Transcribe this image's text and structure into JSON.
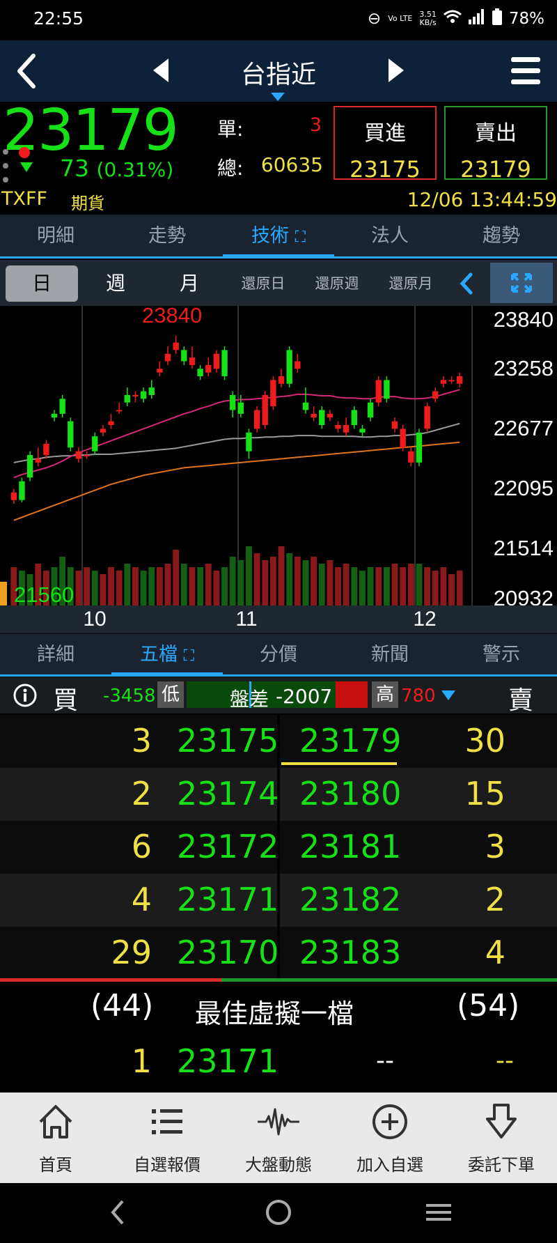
{
  "status": {
    "time": "22:55",
    "volte": "Vo LTE",
    "speed_value": "3.51",
    "speed_unit": "KB/s",
    "battery": "78%"
  },
  "header": {
    "title": "台指近"
  },
  "quote": {
    "price": "23179",
    "change": "73",
    "change_pct": "(0.31%)",
    "single_label": "單:",
    "single_value": "3",
    "total_label": "總:",
    "total_value": "60635",
    "buy_label": "買進",
    "buy_value": "23175",
    "sell_label": "賣出",
    "sell_value": "23179",
    "symbol": "TXFF",
    "type": "期貨",
    "datetime": "12/06 13:44:59"
  },
  "tabs_top": [
    "明細",
    "走勢",
    "技術",
    "法人",
    "趨勢"
  ],
  "tabs_top_active": "技術",
  "period": {
    "day": "日",
    "week": "週",
    "month": "月",
    "r_day": "還原日",
    "r_week": "還原週",
    "r_month": "還原月"
  },
  "chart_data": {
    "type": "candlestick",
    "high_label": "23840",
    "low_label": "21560",
    "price_axis": [
      "23840",
      "23258",
      "22677",
      "22095",
      "21514",
      "20932"
    ],
    "x_labels": [
      "10",
      "11",
      "12"
    ],
    "candles": [
      [
        21650,
        21750,
        21600,
        21800
      ],
      [
        21900,
        21650,
        21620,
        21950
      ],
      [
        22250,
        21950,
        21900,
        22300
      ],
      [
        22150,
        22200,
        22100,
        22350
      ],
      [
        22250,
        22400,
        22200,
        22450
      ],
      [
        22800,
        22750,
        22700,
        22850
      ],
      [
        23000,
        22800,
        22750,
        23050
      ],
      [
        22700,
        22350,
        22300,
        22750
      ],
      [
        22200,
        22300,
        22150,
        22350
      ],
      [
        22250,
        22250,
        22200,
        22300
      ],
      [
        22500,
        22300,
        22250,
        22550
      ],
      [
        22550,
        22600,
        22500,
        22650
      ],
      [
        22650,
        22700,
        22600,
        22800
      ],
      [
        22850,
        22850,
        22800,
        22950
      ],
      [
        23050,
        22950,
        22900,
        23150
      ],
      [
        23050,
        23050,
        22950,
        23100
      ],
      [
        23100,
        23000,
        22950,
        23150
      ],
      [
        23150,
        23050,
        23000,
        23250
      ],
      [
        23350,
        23400,
        23300,
        23500
      ],
      [
        23500,
        23600,
        23450,
        23700
      ],
      [
        23650,
        23750,
        23600,
        23840
      ],
      [
        23650,
        23500,
        23450,
        23700
      ],
      [
        23450,
        23550,
        23400,
        23700
      ],
      [
        23400,
        23300,
        23250,
        23450
      ],
      [
        23350,
        23450,
        23300,
        23550
      ],
      [
        23400,
        23600,
        23350,
        23650
      ],
      [
        23650,
        23300,
        23250,
        23700
      ],
      [
        23050,
        22850,
        22750,
        23100
      ],
      [
        22950,
        22800,
        22750,
        23050
      ],
      [
        22550,
        22300,
        22200,
        22600
      ],
      [
        22600,
        22850,
        22550,
        22900
      ],
      [
        22650,
        23050,
        22600,
        23100
      ],
      [
        22900,
        23250,
        22850,
        23300
      ],
      [
        23200,
        23300,
        23150,
        23400
      ],
      [
        23650,
        23200,
        23150,
        23700
      ],
      [
        23400,
        23500,
        23350,
        23600
      ],
      [
        22950,
        22850,
        22800,
        23150
      ],
      [
        22750,
        22800,
        22700,
        22900
      ],
      [
        22850,
        22650,
        22600,
        22900
      ],
      [
        22750,
        22800,
        22700,
        22850
      ],
      [
        22600,
        22650,
        22550,
        22700
      ],
      [
        22550,
        22650,
        22500,
        22750
      ],
      [
        22850,
        22650,
        22600,
        22900
      ],
      [
        22600,
        22550,
        22500,
        22650
      ],
      [
        22950,
        22750,
        22700,
        23000
      ],
      [
        22950,
        23250,
        22900,
        23300
      ],
      [
        23250,
        23000,
        22950,
        23300
      ],
      [
        22600,
        22700,
        22550,
        22750
      ],
      [
        22350,
        22600,
        22300,
        22650
      ],
      [
        22150,
        22300,
        22100,
        22350
      ],
      [
        22550,
        22150,
        22100,
        22600
      ],
      [
        22600,
        22900,
        22550,
        22950
      ],
      [
        23000,
        23100,
        22950,
        23150
      ],
      [
        23200,
        23250,
        23150,
        23300
      ],
      [
        23250,
        23250,
        23200,
        23300
      ],
      [
        23200,
        23300,
        23150,
        23350
      ]
    ],
    "ma_short": [
      21950,
      21990,
      22020,
      22050,
      22080,
      22120,
      22170,
      22230,
      22280,
      22320,
      22360,
      22400,
      22440,
      22480,
      22520,
      22560,
      22600,
      22640,
      22680,
      22720,
      22760,
      22800,
      22830,
      22870,
      22900,
      22940,
      22970,
      22980,
      22990,
      22990,
      23000,
      23010,
      23020,
      23030,
      23040,
      23060,
      23060,
      23050,
      23040,
      23040,
      23020,
      23010,
      23010,
      23000,
      23000,
      23020,
      23030,
      23030,
      23010,
      23000,
      23000,
      23010,
      23030,
      23060,
      23090,
      23120
    ],
    "ma_mid": [
      22150,
      22170,
      22190,
      22200,
      22220,
      22230,
      22240,
      22240,
      22250,
      22250,
      22260,
      22260,
      22260,
      22270,
      22280,
      22290,
      22300,
      22310,
      22320,
      22330,
      22340,
      22360,
      22380,
      22400,
      22420,
      22440,
      22460,
      22470,
      22470,
      22480,
      22480,
      22490,
      22490,
      22500,
      22500,
      22510,
      22510,
      22510,
      22500,
      22500,
      22500,
      22500,
      22500,
      22490,
      22490,
      22500,
      22500,
      22510,
      22510,
      22520,
      22530,
      22550,
      22580,
      22610,
      22640,
      22670
    ],
    "ma_long": [
      21380,
      21420,
      21460,
      21500,
      21540,
      21580,
      21620,
      21660,
      21700,
      21740,
      21780,
      21820,
      21860,
      21890,
      21920,
      21950,
      21980,
      22000,
      22020,
      22040,
      22060,
      22080,
      22090,
      22100,
      22110,
      22120,
      22130,
      22140,
      22150,
      22160,
      22170,
      22180,
      22190,
      22200,
      22210,
      22220,
      22230,
      22240,
      22250,
      22260,
      22270,
      22280,
      22290,
      22300,
      22310,
      22320,
      22330,
      22340,
      22350,
      22360,
      22370,
      22380,
      22390,
      22400,
      22410,
      22420
    ],
    "volume": [
      0.55,
      0.5,
      0.45,
      0.6,
      0.5,
      0.55,
      0.7,
      0.55,
      0.5,
      0.55,
      0.5,
      0.45,
      0.55,
      0.5,
      0.6,
      0.55,
      0.5,
      0.55,
      0.55,
      0.6,
      0.8,
      0.6,
      0.55,
      0.55,
      0.6,
      0.5,
      0.55,
      0.7,
      0.65,
      0.85,
      0.75,
      0.65,
      0.7,
      0.85,
      0.75,
      0.7,
      0.65,
      0.7,
      0.6,
      0.65,
      0.55,
      0.6,
      0.55,
      0.5,
      0.55,
      0.55,
      0.55,
      0.6,
      0.55,
      0.6,
      0.6,
      0.55,
      0.5,
      0.55,
      0.45,
      0.5
    ]
  },
  "tabs_mid": [
    "詳細",
    "五檔",
    "分價",
    "新聞",
    "警示"
  ],
  "tabs_mid_active": "五檔",
  "five": {
    "buy_label": "買",
    "sell_label": "賣",
    "low_diff": "-3458",
    "low_label": "低",
    "spread_label": "盤差",
    "spread_value": "-2007",
    "high_label": "高",
    "high_diff": "780",
    "rows": [
      {
        "bq": "3",
        "bp": "23175",
        "sp": "23179",
        "sq": "30"
      },
      {
        "bq": "2",
        "bp": "23174",
        "sp": "23180",
        "sq": "15"
      },
      {
        "bq": "6",
        "bp": "23172",
        "sp": "23181",
        "sq": "3"
      },
      {
        "bq": "4",
        "bp": "23171",
        "sp": "23182",
        "sq": "2"
      },
      {
        "bq": "29",
        "bp": "23170",
        "sp": "23183",
        "sq": "4"
      }
    ],
    "buy_total": "(44)",
    "sell_total": "(54)",
    "virtual_label": "最佳虛擬一檔",
    "virtual": {
      "bq": "1",
      "bp": "23171",
      "sp": "--",
      "sq": "--"
    }
  },
  "bottom_nav": [
    {
      "label": "首頁",
      "icon": "home-icon"
    },
    {
      "label": "自選報價",
      "icon": "list-icon"
    },
    {
      "label": "大盤動態",
      "icon": "pulse-icon"
    },
    {
      "label": "加入自選",
      "icon": "add-circle-icon"
    },
    {
      "label": "委託下單",
      "icon": "order-down-icon"
    }
  ],
  "colors": {
    "up": "#ee1c1c",
    "down": "#16e016",
    "accent": "#2aa8ff",
    "qty": "#f0e046"
  }
}
